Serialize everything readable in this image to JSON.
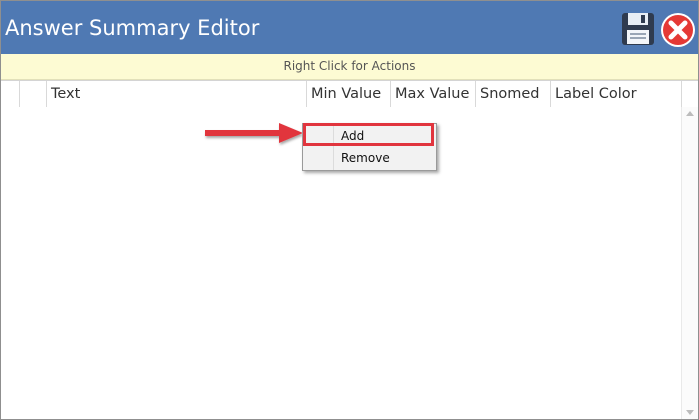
{
  "window": {
    "title": "Answer Summary Editor"
  },
  "toolbar": {
    "save_icon": "floppy-disk-save-icon",
    "close_icon": "red-circle-close-icon"
  },
  "hint_bar": {
    "text": "Right Click for Actions"
  },
  "grid": {
    "columns": [
      "",
      "",
      "Text",
      "Min Value",
      "Max Value",
      "Snomed",
      "Label Color"
    ],
    "rows": []
  },
  "context_menu": {
    "items": [
      {
        "label": "Add",
        "highlighted": true
      },
      {
        "label": "Remove",
        "highlighted": false
      }
    ]
  },
  "colors": {
    "titlebar": "#4f79b3",
    "hint_bar": "#fdfbd3",
    "annotation": "#e1353e"
  }
}
